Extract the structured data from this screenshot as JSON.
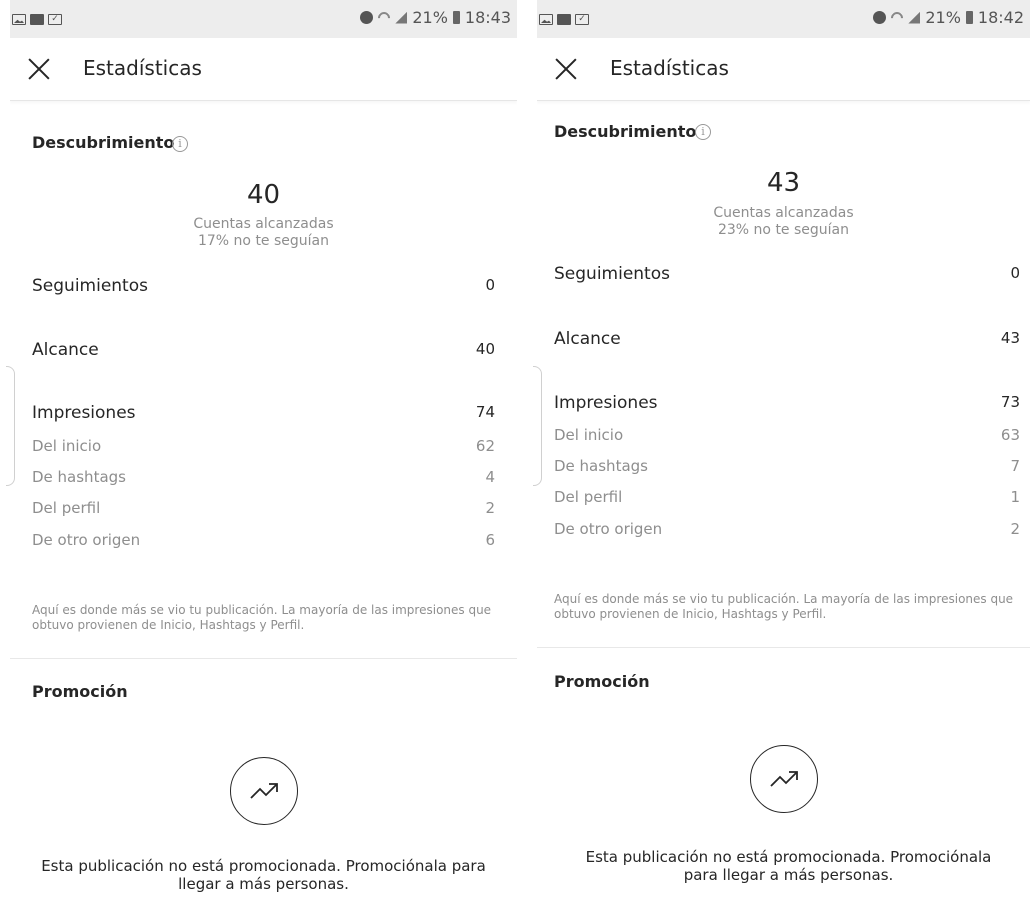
{
  "screens": [
    {
      "status": {
        "battery": "21%",
        "time": "18:43"
      },
      "title": "Estadísticas",
      "discovery": {
        "title": "Descubrimiento",
        "info": "i",
        "accounts": "40",
        "accounts_label": "Cuentas alcanzadas",
        "not_following": "17% no te seguían"
      },
      "rows": [
        {
          "label": "Seguimientos",
          "value": "0"
        },
        {
          "label": "Alcance",
          "value": "40"
        },
        {
          "label": "Impresiones",
          "value": "74"
        }
      ],
      "impressions": [
        {
          "label": "Del inicio",
          "value": "62"
        },
        {
          "label": "De hashtags",
          "value": "4"
        },
        {
          "label": "Del perfil",
          "value": "2"
        },
        {
          "label": "De otro origen",
          "value": "6"
        }
      ],
      "description": "Aquí es donde más se vio tu publicación. La mayoría de las impresiones que obtuvo provienen de Inicio, Hashtags y Perfil.",
      "promotion": {
        "title": "Promoción",
        "text": "Esta publicación no está promocionada. Promociónala para llegar a más personas."
      }
    },
    {
      "status": {
        "battery": "21%",
        "time": "18:42"
      },
      "title": "Estadísticas",
      "discovery": {
        "title": "Descubrimiento",
        "info": "i",
        "accounts": "43",
        "accounts_label": "Cuentas alcanzadas",
        "not_following": "23% no te seguían"
      },
      "rows": [
        {
          "label": "Seguimientos",
          "value": "0"
        },
        {
          "label": "Alcance",
          "value": "43"
        },
        {
          "label": "Impresiones",
          "value": "73"
        }
      ],
      "impressions": [
        {
          "label": "Del inicio",
          "value": "63"
        },
        {
          "label": "De hashtags",
          "value": "7"
        },
        {
          "label": "Del perfil",
          "value": "1"
        },
        {
          "label": "De otro origen",
          "value": "2"
        }
      ],
      "description": "Aquí es donde más se vio tu publicación. La mayoría de las impresiones que obtuvo provienen de Inicio, Hashtags y Perfil.",
      "promotion": {
        "title": "Promoción",
        "text": "Esta publicación no está promocionada. Promociónala para llegar a más personas."
      }
    }
  ],
  "icons": {
    "close": "close-icon",
    "info": "info-icon",
    "promote": "trending-up-icon"
  }
}
